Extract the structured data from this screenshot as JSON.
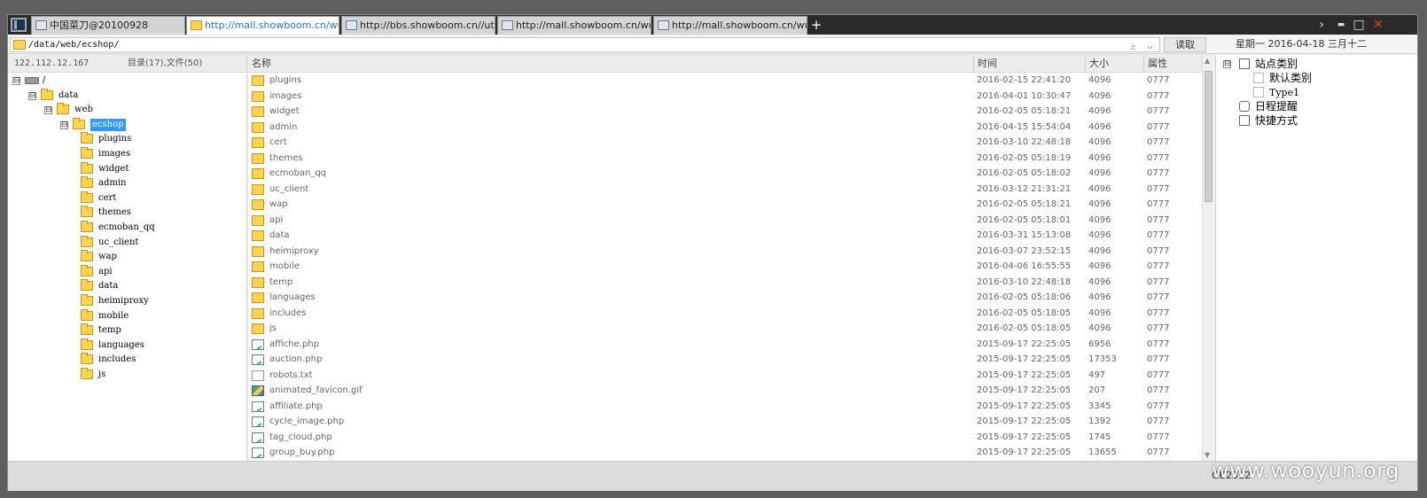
{
  "tabs": [
    {
      "label": "中国菜刀@20100928",
      "icon": "page-icon",
      "active": false
    },
    {
      "label": "http://mall.showboom.cn/wuy...",
      "icon": "folder-icon",
      "active": true
    },
    {
      "label": "http://bbs.showboom.cn//utili...",
      "icon": "page-icon",
      "active": false
    },
    {
      "label": "http://mall.showboom.cn/wuy...",
      "icon": "page-icon",
      "active": false
    },
    {
      "label": "http://mall.showboom.cn/wuy...",
      "icon": "page-icon",
      "active": false
    }
  ],
  "tab_add": "+",
  "window_controls": {
    "chevron": "›",
    "minimize": "▬",
    "maximize": "□",
    "close": "✕"
  },
  "pathbar": {
    "path": "/data/web/ecshop/",
    "plusminus": "±",
    "dropdown": "⌵",
    "read_label": "读取",
    "date": "星期一 2016-04-18 三月十二"
  },
  "left": {
    "ip": "122.112.12.167",
    "counts": "目录(17),文件(50)",
    "tree": [
      "/",
      "data",
      "web",
      "ecshop",
      "plugins",
      "images",
      "widget",
      "admin",
      "cert",
      "themes",
      "ecmoban_qq",
      "uc_client",
      "wap",
      "api",
      "data",
      "heimiproxy",
      "mobile",
      "temp",
      "languages",
      "includes",
      "js"
    ],
    "expanders": [
      "⊟",
      "⊟",
      "⊟",
      "⊟"
    ]
  },
  "main": {
    "headers": {
      "name": "名称",
      "time": "时间",
      "size": "大小",
      "attr": "属性"
    },
    "rows": [
      {
        "name": "plugins",
        "time": "2016-02-15 22:41:20",
        "size": "4096",
        "attr": "0777",
        "type": "folder"
      },
      {
        "name": "images",
        "time": "2016-04-01 10:30:47",
        "size": "4096",
        "attr": "0777",
        "type": "folder"
      },
      {
        "name": "widget",
        "time": "2016-02-05 05:18:21",
        "size": "4096",
        "attr": "0777",
        "type": "folder"
      },
      {
        "name": "admin",
        "time": "2016-04-15 15:54:04",
        "size": "4096",
        "attr": "0777",
        "type": "folder"
      },
      {
        "name": "cert",
        "time": "2016-03-10 22:48:18",
        "size": "4096",
        "attr": "0777",
        "type": "folder"
      },
      {
        "name": "themes",
        "time": "2016-02-05 05:18:19",
        "size": "4096",
        "attr": "0777",
        "type": "folder"
      },
      {
        "name": "ecmoban_qq",
        "time": "2016-02-05 05:18:02",
        "size": "4096",
        "attr": "0777",
        "type": "folder"
      },
      {
        "name": "uc_client",
        "time": "2016-03-12 21:31:21",
        "size": "4096",
        "attr": "0777",
        "type": "folder"
      },
      {
        "name": "wap",
        "time": "2016-02-05 05:18:21",
        "size": "4096",
        "attr": "0777",
        "type": "folder"
      },
      {
        "name": "api",
        "time": "2016-02-05 05:18:01",
        "size": "4096",
        "attr": "0777",
        "type": "folder"
      },
      {
        "name": "data",
        "time": "2016-03-31 15:13:08",
        "size": "4096",
        "attr": "0777",
        "type": "folder"
      },
      {
        "name": "heimiproxy",
        "time": "2016-03-07 23:52:15",
        "size": "4096",
        "attr": "0777",
        "type": "folder"
      },
      {
        "name": "mobile",
        "time": "2016-04-06 16:55:55",
        "size": "4096",
        "attr": "0777",
        "type": "folder"
      },
      {
        "name": "temp",
        "time": "2016-03-10 22:48:18",
        "size": "4096",
        "attr": "0777",
        "type": "folder"
      },
      {
        "name": "languages",
        "time": "2016-02-05 05:18:06",
        "size": "4096",
        "attr": "0777",
        "type": "folder"
      },
      {
        "name": "includes",
        "time": "2016-02-05 05:18:05",
        "size": "4096",
        "attr": "0777",
        "type": "folder"
      },
      {
        "name": "js",
        "time": "2016-02-05 05:18:05",
        "size": "4096",
        "attr": "0777",
        "type": "folder"
      },
      {
        "name": "affiche.php",
        "time": "2015-09-17 22:25:05",
        "size": "6956",
        "attr": "0777",
        "type": "php"
      },
      {
        "name": "auction.php",
        "time": "2015-09-17 22:25:05",
        "size": "17353",
        "attr": "0777",
        "type": "php"
      },
      {
        "name": "robots.txt",
        "time": "2015-09-17 22:25:05",
        "size": "497",
        "attr": "0777",
        "type": "txt"
      },
      {
        "name": "animated_favicon.gif",
        "time": "2015-09-17 22:25:05",
        "size": "207",
        "attr": "0777",
        "type": "gif"
      },
      {
        "name": "affiliate.php",
        "time": "2015-09-17 22:25:05",
        "size": "3345",
        "attr": "0777",
        "type": "php"
      },
      {
        "name": "cycle_image.php",
        "time": "2015-09-17 22:25:05",
        "size": "1392",
        "attr": "0777",
        "type": "php"
      },
      {
        "name": "tag_cloud.php",
        "time": "2015-09-17 22:25:05",
        "size": "1745",
        "attr": "0777",
        "type": "php"
      },
      {
        "name": "group_buy.php",
        "time": "2015-09-17 22:25:05",
        "size": "13655",
        "attr": "0777",
        "type": "php"
      }
    ]
  },
  "right": {
    "items": [
      "站点类别",
      "默认类别",
      "Type1",
      "日程提醒",
      "快捷方式"
    ],
    "expander": "⊟"
  },
  "status": {
    "encoding": "GB2312",
    "watermark": "www.wooyun.org"
  },
  "scroll": {
    "up": "▲",
    "down": "▼"
  }
}
